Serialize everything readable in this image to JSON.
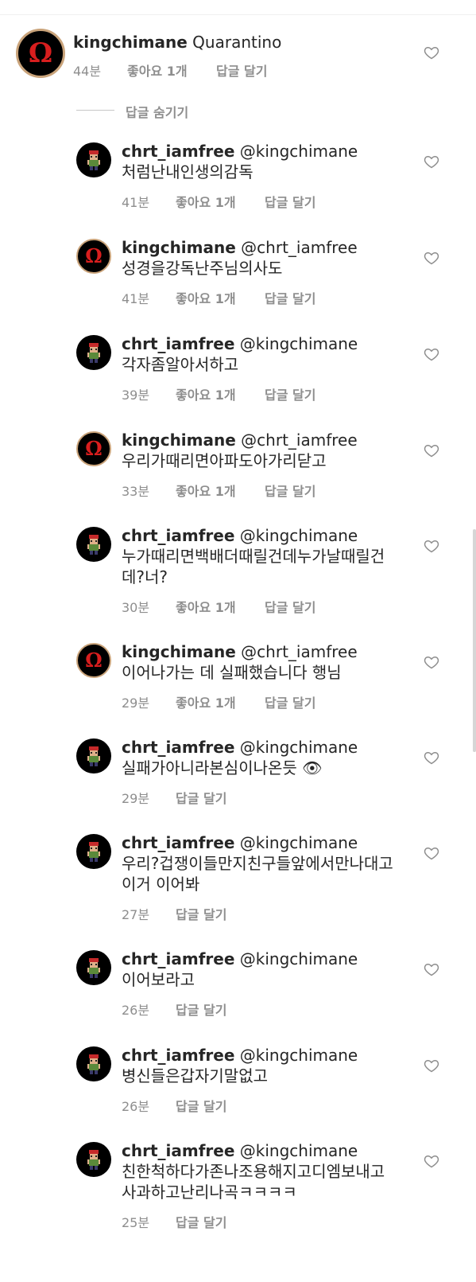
{
  "parent_comment": {
    "username": "kingchimane",
    "text": "Quarantino",
    "time": "44분",
    "likes": "좋아요 1개",
    "reply": "답글 달기"
  },
  "hide_replies_label": "답글 숨기기",
  "replies": [
    {
      "username": "chrt_iamfree",
      "mention": "@kingchimane",
      "lines": [
        "처럼난내인생의감독"
      ],
      "time": "41분",
      "likes": "좋아요 1개",
      "reply": "답글 달기"
    },
    {
      "username": "kingchimane",
      "mention": "@chrt_iamfree",
      "lines": [
        "성경을강독난주님의사도"
      ],
      "time": "41분",
      "likes": "좋아요 1개",
      "reply": "답글 달기"
    },
    {
      "username": "chrt_iamfree",
      "mention": "@kingchimane",
      "lines": [
        "각자좀알아서하고"
      ],
      "time": "39분",
      "likes": "좋아요 1개",
      "reply": "답글 달기"
    },
    {
      "username": "kingchimane",
      "mention": "@chrt_iamfree",
      "lines": [
        "우리가때리면아파도아가리닫고"
      ],
      "time": "33분",
      "likes": "좋아요 1개",
      "reply": "답글 달기"
    },
    {
      "username": "chrt_iamfree",
      "mention": "@kingchimane",
      "lines": [
        "누가때리면백배더때릴건데누가날때릴건",
        "데?너?"
      ],
      "time": "30분",
      "likes": "좋아요 1개",
      "reply": "답글 달기"
    },
    {
      "username": "kingchimane",
      "mention": "@chrt_iamfree",
      "lines": [
        "이어나가는 데 실패했습니다 행님"
      ],
      "time": "29분",
      "likes": "좋아요 1개",
      "reply": "답글 달기"
    },
    {
      "username": "chrt_iamfree",
      "mention": "@kingchimane",
      "lines": [
        "실패가아니라본심이나온듯 👁"
      ],
      "time": "29분",
      "likes": "",
      "reply": "답글 달기"
    },
    {
      "username": "chrt_iamfree",
      "mention": "@kingchimane",
      "lines": [
        "우리?겁쟁이들만지친구들앞에서만나대고",
        "이거 이어봐"
      ],
      "time": "27분",
      "likes": "",
      "reply": "답글 달기"
    },
    {
      "username": "chrt_iamfree",
      "mention": "@kingchimane",
      "lines": [
        "이어보라고"
      ],
      "time": "26분",
      "likes": "",
      "reply": "답글 달기"
    },
    {
      "username": "chrt_iamfree",
      "mention": "@kingchimane",
      "lines": [
        "병신들은갑자기말없고"
      ],
      "time": "26분",
      "likes": "",
      "reply": "답글 달기"
    },
    {
      "username": "chrt_iamfree",
      "mention": "@kingchimane",
      "lines": [
        "친한척하다가존나조용해지고디엠보내고",
        "사과하고난리나곡ㅋㅋㅋㅋ"
      ],
      "time": "25분",
      "likes": "",
      "reply": "답글 달기"
    }
  ]
}
